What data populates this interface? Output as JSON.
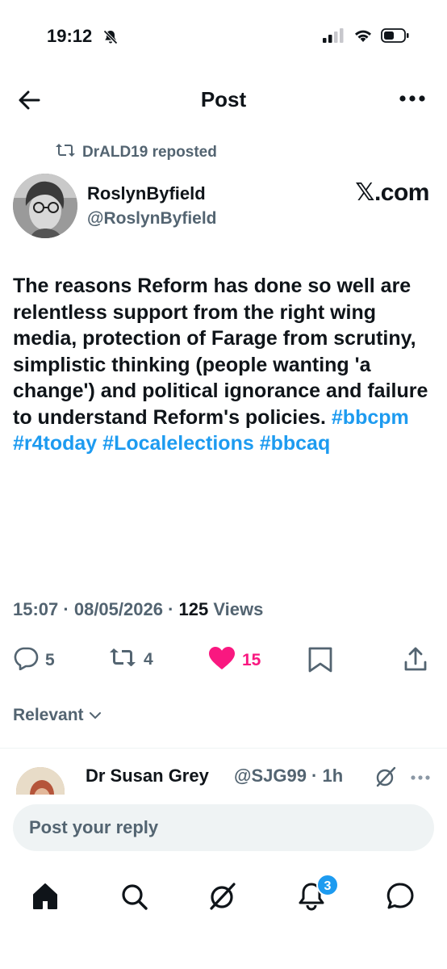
{
  "status_bar": {
    "time": "19:12"
  },
  "nav": {
    "title": "Post"
  },
  "repost": {
    "text": "DrALD19 reposted"
  },
  "author": {
    "name": "RoslynByfield",
    "handle": "@RoslynByfield",
    "badge": "𝕏.com"
  },
  "post": {
    "text_plain": "The reasons Reform has done so well are relentless support from the right wing media, protection of Farage from scrutiny, simplistic thinking (people wanting 'a change') and political ignorance and failure to understand Reform's policies.",
    "hashtags": [
      "#bbcpm",
      "#r4today",
      "#Localelections",
      "#bbcaq"
    ]
  },
  "meta": {
    "time": "15:07",
    "sep1": " · ",
    "date": "08/05/2026",
    "sep2": " · ",
    "views_count": "125",
    "views_label": " Views"
  },
  "actions": {
    "replies": "5",
    "reposts": "4",
    "likes": "15"
  },
  "sort": {
    "label": "Relevant"
  },
  "reply": {
    "name": "Dr Susan Grey",
    "handle": "@SJG99 · 1h"
  },
  "reply_bar": {
    "placeholder": "Post your reply"
  },
  "tabbar": {
    "notifications_badge": "3"
  },
  "colors": {
    "accent": "#1d9bf0",
    "like": "#f91880",
    "muted": "#536471",
    "text": "#0f1419"
  }
}
